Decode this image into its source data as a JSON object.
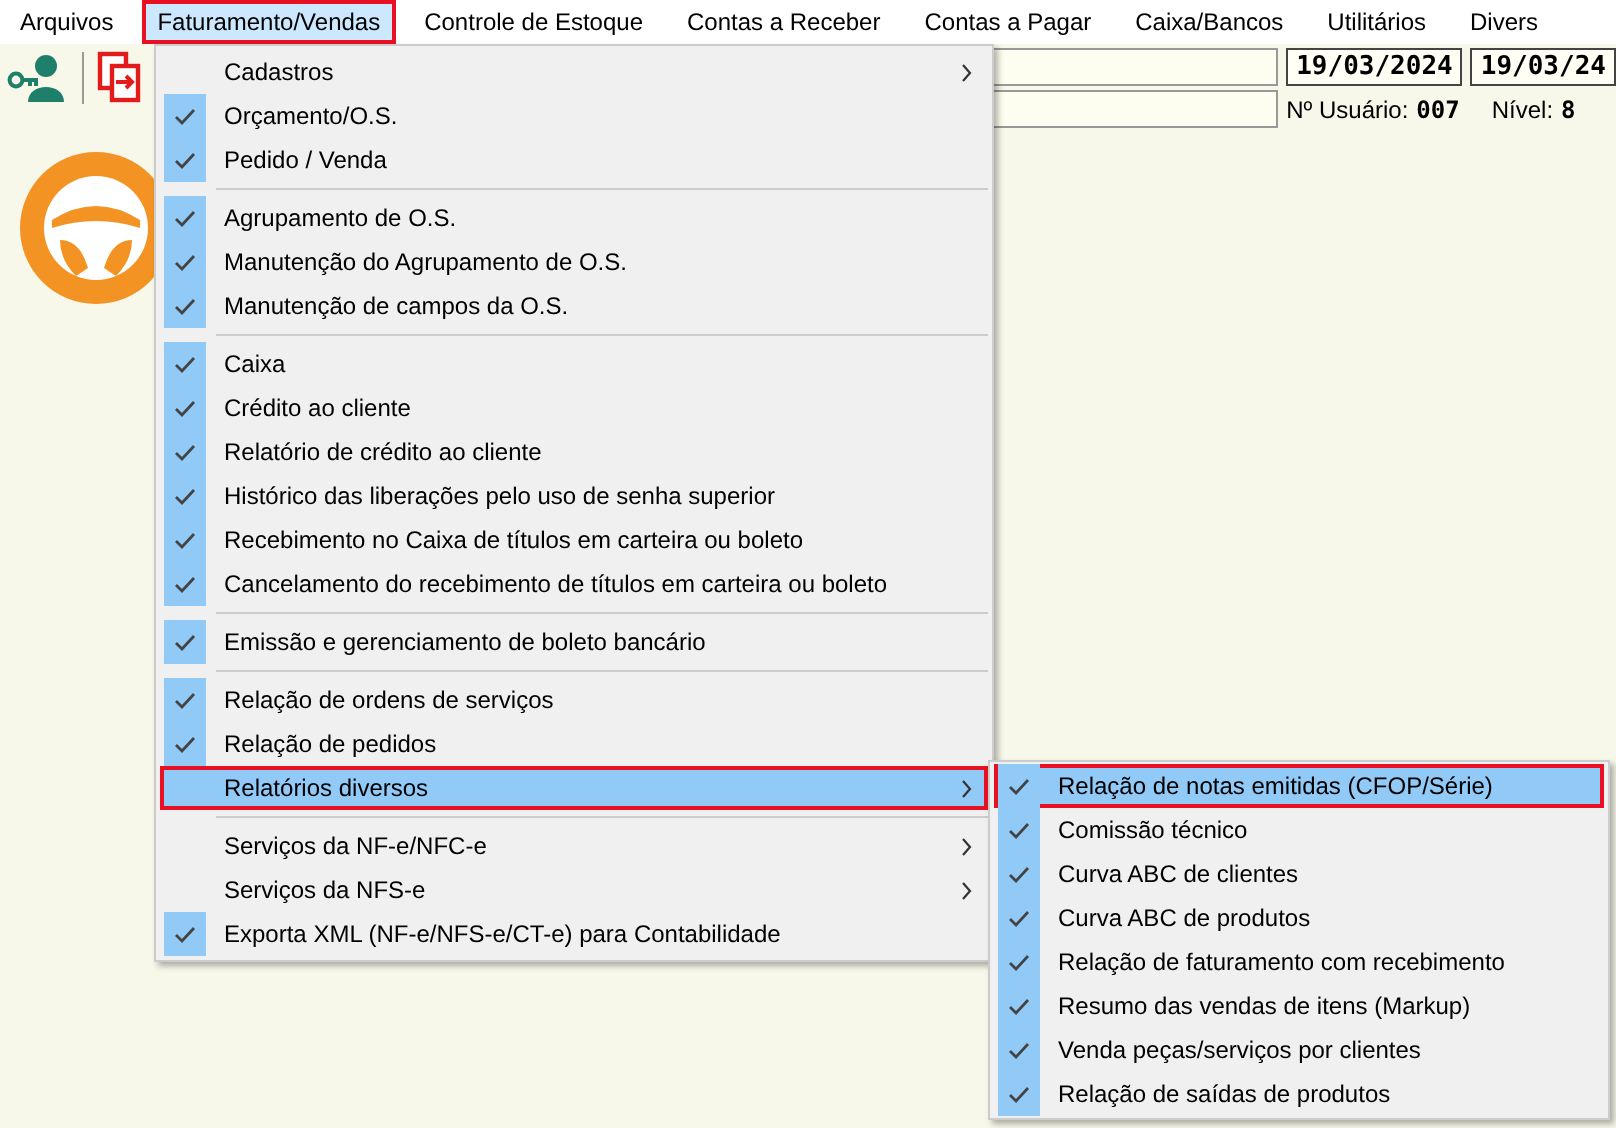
{
  "menubar": [
    {
      "label": "Arquivos",
      "selected": false
    },
    {
      "label": "Faturamento/Vendas",
      "selected": true
    },
    {
      "label": "Controle de Estoque",
      "selected": false
    },
    {
      "label": "Contas a Receber",
      "selected": false
    },
    {
      "label": "Contas a Pagar",
      "selected": false
    },
    {
      "label": "Caixa/Bancos",
      "selected": false
    },
    {
      "label": "Utilitários",
      "selected": false
    },
    {
      "label": "Divers",
      "selected": false
    }
  ],
  "header": {
    "date_start": "19/03/2024",
    "date_end": "19/03/24",
    "user_label": "Nº Usuário:",
    "user_value": "007",
    "level_label": "Nível:",
    "level_value": "8"
  },
  "menu": {
    "items": [
      {
        "kind": "item",
        "label": "Cadastros",
        "checked": false,
        "submenu": true,
        "selected": false
      },
      {
        "kind": "item",
        "label": "Orçamento/O.S.",
        "checked": true,
        "submenu": false,
        "selected": false
      },
      {
        "kind": "item",
        "label": "Pedido / Venda",
        "checked": true,
        "submenu": false,
        "selected": false
      },
      {
        "kind": "separator"
      },
      {
        "kind": "item",
        "label": "Agrupamento de O.S.",
        "checked": true,
        "submenu": false,
        "selected": false
      },
      {
        "kind": "item",
        "label": "Manutenção do Agrupamento de O.S.",
        "checked": true,
        "submenu": false,
        "selected": false
      },
      {
        "kind": "item",
        "label": "Manutenção de campos da O.S.",
        "checked": true,
        "submenu": false,
        "selected": false
      },
      {
        "kind": "separator"
      },
      {
        "kind": "item",
        "label": "Caixa",
        "checked": true,
        "submenu": false,
        "selected": false
      },
      {
        "kind": "item",
        "label": "Crédito ao cliente",
        "checked": true,
        "submenu": false,
        "selected": false
      },
      {
        "kind": "item",
        "label": "Relatório de crédito ao cliente",
        "checked": true,
        "submenu": false,
        "selected": false
      },
      {
        "kind": "item",
        "label": "Histórico das liberações pelo uso de senha superior",
        "checked": true,
        "submenu": false,
        "selected": false
      },
      {
        "kind": "item",
        "label": "Recebimento no Caixa de títulos em carteira ou boleto",
        "checked": true,
        "submenu": false,
        "selected": false
      },
      {
        "kind": "item",
        "label": "Cancelamento do recebimento de títulos em carteira ou boleto",
        "checked": true,
        "submenu": false,
        "selected": false
      },
      {
        "kind": "separator"
      },
      {
        "kind": "item",
        "label": "Emissão e gerenciamento de boleto bancário",
        "checked": true,
        "submenu": false,
        "selected": false
      },
      {
        "kind": "separator"
      },
      {
        "kind": "item",
        "label": "Relação de ordens de serviços",
        "checked": true,
        "submenu": false,
        "selected": false
      },
      {
        "kind": "item",
        "label": "Relação de pedidos",
        "checked": true,
        "submenu": false,
        "selected": false
      },
      {
        "kind": "item",
        "label": "Relatórios diversos",
        "checked": false,
        "submenu": true,
        "selected": true
      },
      {
        "kind": "separator"
      },
      {
        "kind": "item",
        "label": "Serviços da NF-e/NFC-e",
        "checked": false,
        "submenu": true,
        "selected": false
      },
      {
        "kind": "item",
        "label": "Serviços da NFS-e",
        "checked": false,
        "submenu": true,
        "selected": false
      },
      {
        "kind": "item",
        "label": "Exporta XML (NF-e/NFS-e/CT-e) para Contabilidade",
        "checked": true,
        "submenu": false,
        "selected": false
      }
    ]
  },
  "submenu": {
    "items": [
      {
        "kind": "item",
        "label": "Relação de notas emitidas (CFOP/Série)",
        "checked": true,
        "submenu": false,
        "selected": true
      },
      {
        "kind": "item",
        "label": "Comissão técnico",
        "checked": true,
        "submenu": false,
        "selected": false
      },
      {
        "kind": "item",
        "label": "Curva ABC de clientes",
        "checked": true,
        "submenu": false,
        "selected": false
      },
      {
        "kind": "item",
        "label": "Curva ABC de produtos",
        "checked": true,
        "submenu": false,
        "selected": false
      },
      {
        "kind": "item",
        "label": "Relação de faturamento com recebimento",
        "checked": true,
        "submenu": false,
        "selected": false
      },
      {
        "kind": "item",
        "label": "Resumo das vendas de itens (Markup)",
        "checked": true,
        "submenu": false,
        "selected": false
      },
      {
        "kind": "item",
        "label": "Venda peças/serviços por clientes",
        "checked": true,
        "submenu": false,
        "selected": false
      },
      {
        "kind": "item",
        "label": "Relação de saídas de produtos",
        "checked": true,
        "submenu": false,
        "selected": false
      }
    ]
  }
}
